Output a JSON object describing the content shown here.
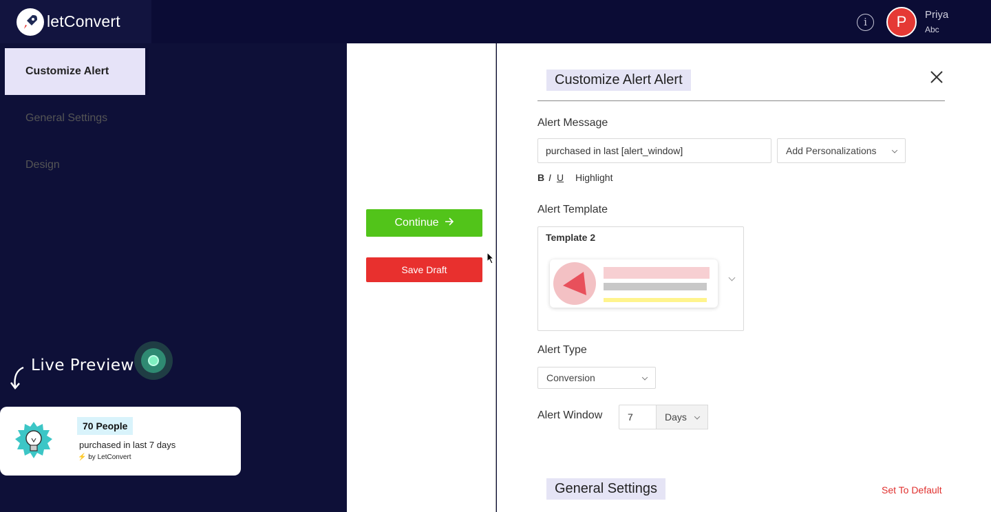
{
  "app": {
    "brand": "letConvert",
    "user_name": "Priya",
    "user_sub": "Abc",
    "avatar_initial": "P"
  },
  "live_preview": {
    "label": "Live Preview",
    "count": "70 People",
    "message": "purchased in last 7 days",
    "by": "by LetConvert"
  },
  "menu": {
    "items": [
      {
        "label": "Customize Alert",
        "active": true
      },
      {
        "label": "General Settings",
        "active": false
      },
      {
        "label": "Design",
        "active": false
      }
    ],
    "continue_label": "Continue",
    "save_draft_label": "Save Draft"
  },
  "customize": {
    "title": "Customize Alert Alert",
    "alert_message_label": "Alert Message",
    "alert_message_value": "purchased in last [alert_window]",
    "personalizations_label": "Add Personalizations",
    "format": {
      "bold": "B",
      "italic": "I",
      "underline": "U",
      "highlight": "Highlight"
    },
    "alert_template_label": "Alert Template",
    "template_name": "Template 2",
    "alert_type_label": "Alert Type",
    "alert_type_value": "Conversion",
    "alert_window_label": "Alert Window",
    "alert_window_value": "7",
    "alert_window_unit": "Days"
  },
  "general_settings": {
    "title": "General Settings",
    "set_default_label": "Set To Default"
  },
  "colors": {
    "accent": "#0b0c35",
    "continue": "#52c41a",
    "save_draft": "#e8302e",
    "avatar": "#e53935"
  }
}
